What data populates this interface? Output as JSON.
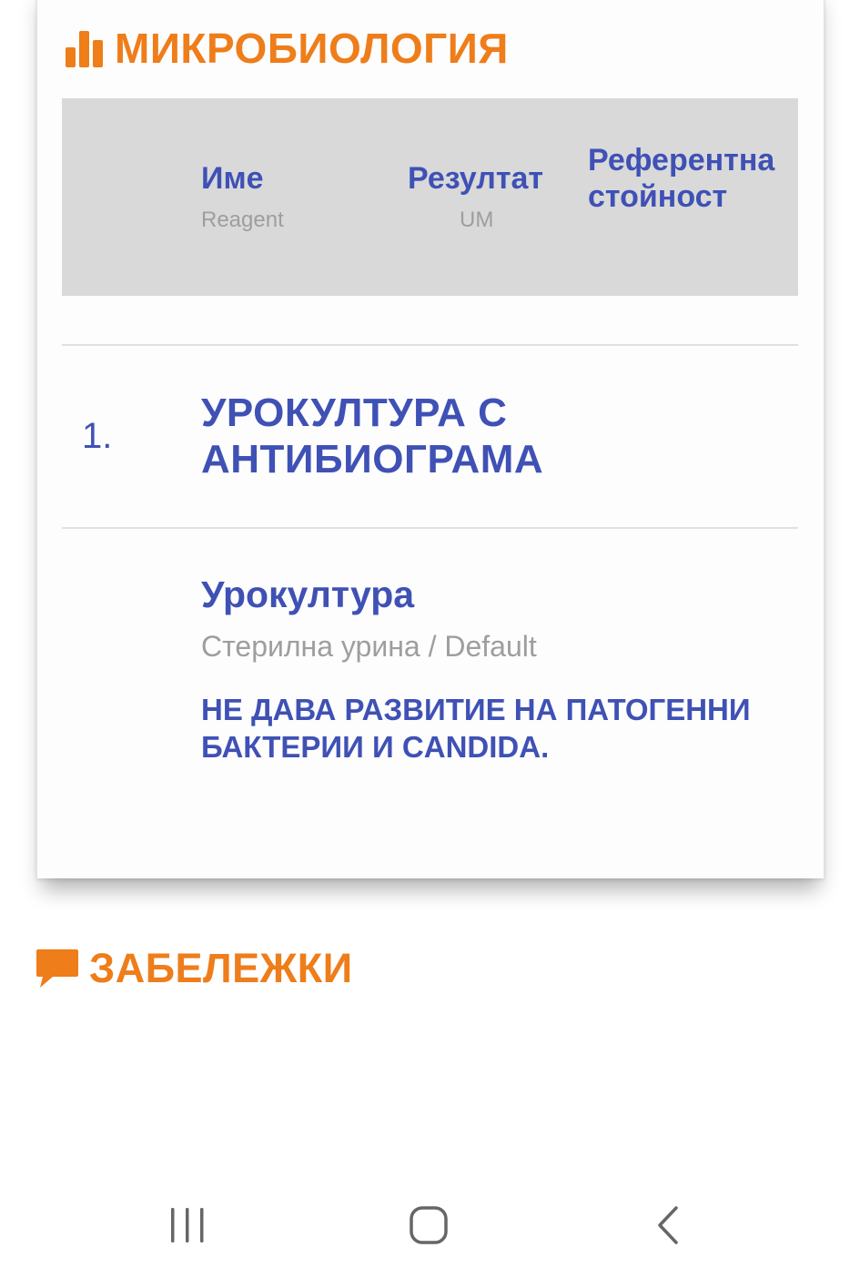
{
  "microbiology": {
    "title": "МИКРОБИОЛОГИЯ",
    "icon": "bar-chart-icon",
    "accent_color": "#ee7d1a",
    "table_header": {
      "name_label": "Име",
      "name_sub": "Reagent",
      "result_label": "Резултат",
      "result_sub": "UM",
      "reference_label_line1": "Референтна",
      "reference_label_line2": "стойност"
    },
    "group": {
      "number": "1.",
      "title_line1": "УРОКУЛТУРА С",
      "title_line2": "АНТИБИОГРАМА"
    },
    "test": {
      "name": "Урокултура",
      "material": "Стерилна урина / Default",
      "result_line1": "НЕ ДАВА РАЗВИТИЕ НА ПАТОГЕННИ",
      "result_line2": "БАКТЕРИИ И CANDIDA."
    }
  },
  "notes": {
    "title": "ЗАБЕЛЕЖКИ",
    "icon": "comment-icon"
  },
  "navbar": {
    "recent_icon": "recent-apps-icon",
    "home_icon": "home-icon",
    "back_icon": "back-icon"
  },
  "colors": {
    "primary_text": "#3f51b5",
    "secondary_text": "#9e9e9e",
    "header_bg": "#d9d9d9"
  }
}
